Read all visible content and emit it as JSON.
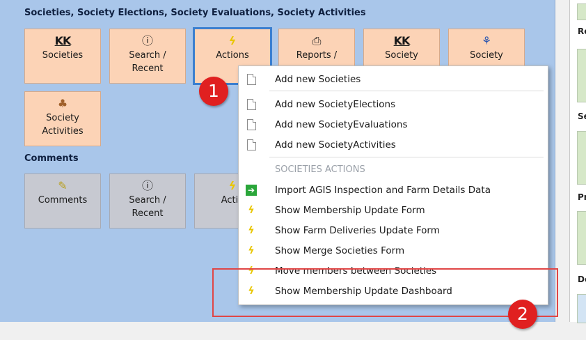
{
  "sections": {
    "top_title": "Societies,  Society Elections,  Society Evaluations,  Society Activities",
    "comments_title": "Comments"
  },
  "tiles": [
    {
      "label": "Societies",
      "icon": "KK"
    },
    {
      "label": "Search /\nRecent",
      "icon": "info-icon"
    },
    {
      "label": "Actions",
      "icon": "lightning-icon"
    },
    {
      "label": "Reports /",
      "icon": "printer-icon"
    },
    {
      "label": "Society",
      "icon": "KK"
    },
    {
      "label": "Society",
      "icon": "people-icon"
    },
    {
      "label": "Society\nActivities",
      "icon": "group-icon"
    }
  ],
  "comment_tiles": [
    {
      "label": "Comments",
      "icon": "comment-icon"
    },
    {
      "label": "Search /\nRecent",
      "icon": "info-icon"
    },
    {
      "label": "Actio",
      "icon": "lightning-icon"
    }
  ],
  "menu": {
    "items": [
      "Add new Societies",
      "Add new SocietyElections",
      "Add new SocietyEvaluations",
      "Add new SocietyActivities",
      "SOCIETIES  ACTIONS",
      "Import AGIS Inspection and Farm Details Data",
      "Show Membership Update Form",
      "Show Farm Deliveries Update Form",
      "Show Merge Societies Form",
      "Move members between Societies",
      "Show Membership Update Dashboard"
    ]
  },
  "badges": [
    "1",
    "2"
  ],
  "right_panel": {
    "labels": [
      "Re",
      "Se",
      "Pr",
      "De"
    ]
  },
  "colors": {
    "panel": "#a9c6ea",
    "tile": "#fcd3b6",
    "grey_tile": "#c7c9d1",
    "badge": "#e02020",
    "highlight": "#e04646"
  }
}
